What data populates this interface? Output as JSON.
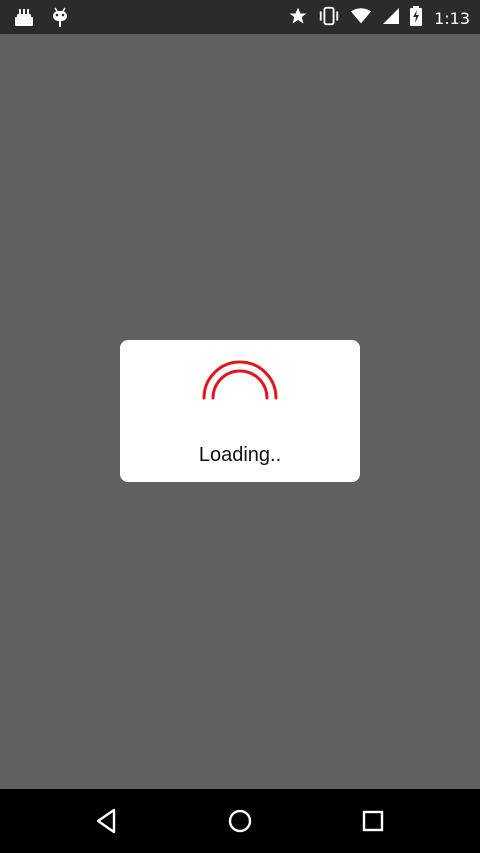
{
  "status_bar": {
    "time": "1:13",
    "left_icons": [
      "cake-notification-icon",
      "android-debug-icon"
    ],
    "right_icons": [
      "star-icon",
      "vibrate-icon",
      "wifi-icon",
      "signal-icon",
      "battery-charging-icon"
    ]
  },
  "dialog": {
    "message": "Loading..",
    "spinner_color": "#e0161d"
  },
  "colors": {
    "status_bar_bg": "#2b2b2b",
    "screen_dim_bg": "#616063",
    "dialog_bg": "#ffffff",
    "nav_bar_bg": "#000000"
  },
  "nav_bar": {
    "buttons": [
      "back-icon",
      "home-icon",
      "recents-icon"
    ]
  }
}
